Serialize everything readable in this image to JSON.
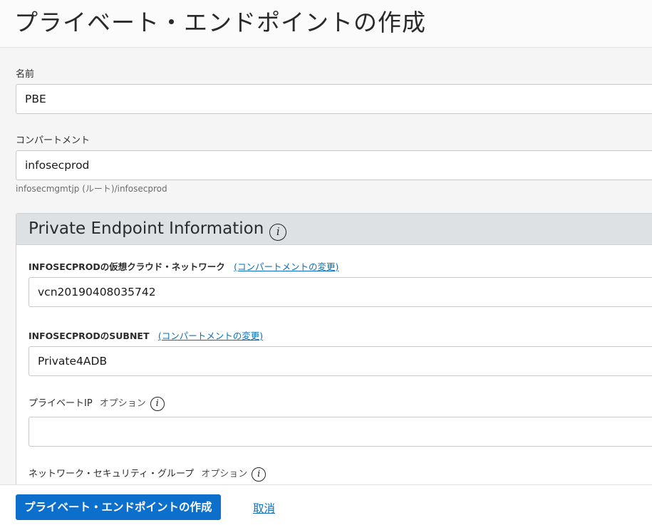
{
  "page": {
    "title": "プライベート・エンドポイントの作成"
  },
  "form": {
    "name": {
      "label": "名前",
      "value": "PBE"
    },
    "compartment": {
      "label": "コンパートメント",
      "value": "infosecprod",
      "hint": "infosecmgmtjp (ルート)/infosecprod"
    },
    "section": {
      "title": "Private Endpoint Information",
      "vcn": {
        "label": "INFOSECPRODの仮想クラウド・ネットワーク",
        "change_link": "(コンパートメントの変更)",
        "value": "vcn20190408035742"
      },
      "subnet": {
        "label": "INFOSECPRODのSUBNET",
        "change_link": "(コンパートメントの変更)",
        "value": "Private4ADB"
      },
      "private_ip": {
        "label": "プライベートIP",
        "optional": "オプション",
        "value": ""
      },
      "nsg": {
        "label": "ネットワーク・セキュリティ・グループ",
        "optional": "オプション"
      }
    }
  },
  "footer": {
    "create_button": "プライベート・エンドポイントの作成",
    "cancel_link": "取消"
  },
  "icons": {
    "info": "info-icon"
  },
  "colors": {
    "primary": "#0b6fcb",
    "link": "#0b6fb8",
    "section_header": "#dde1e4"
  }
}
